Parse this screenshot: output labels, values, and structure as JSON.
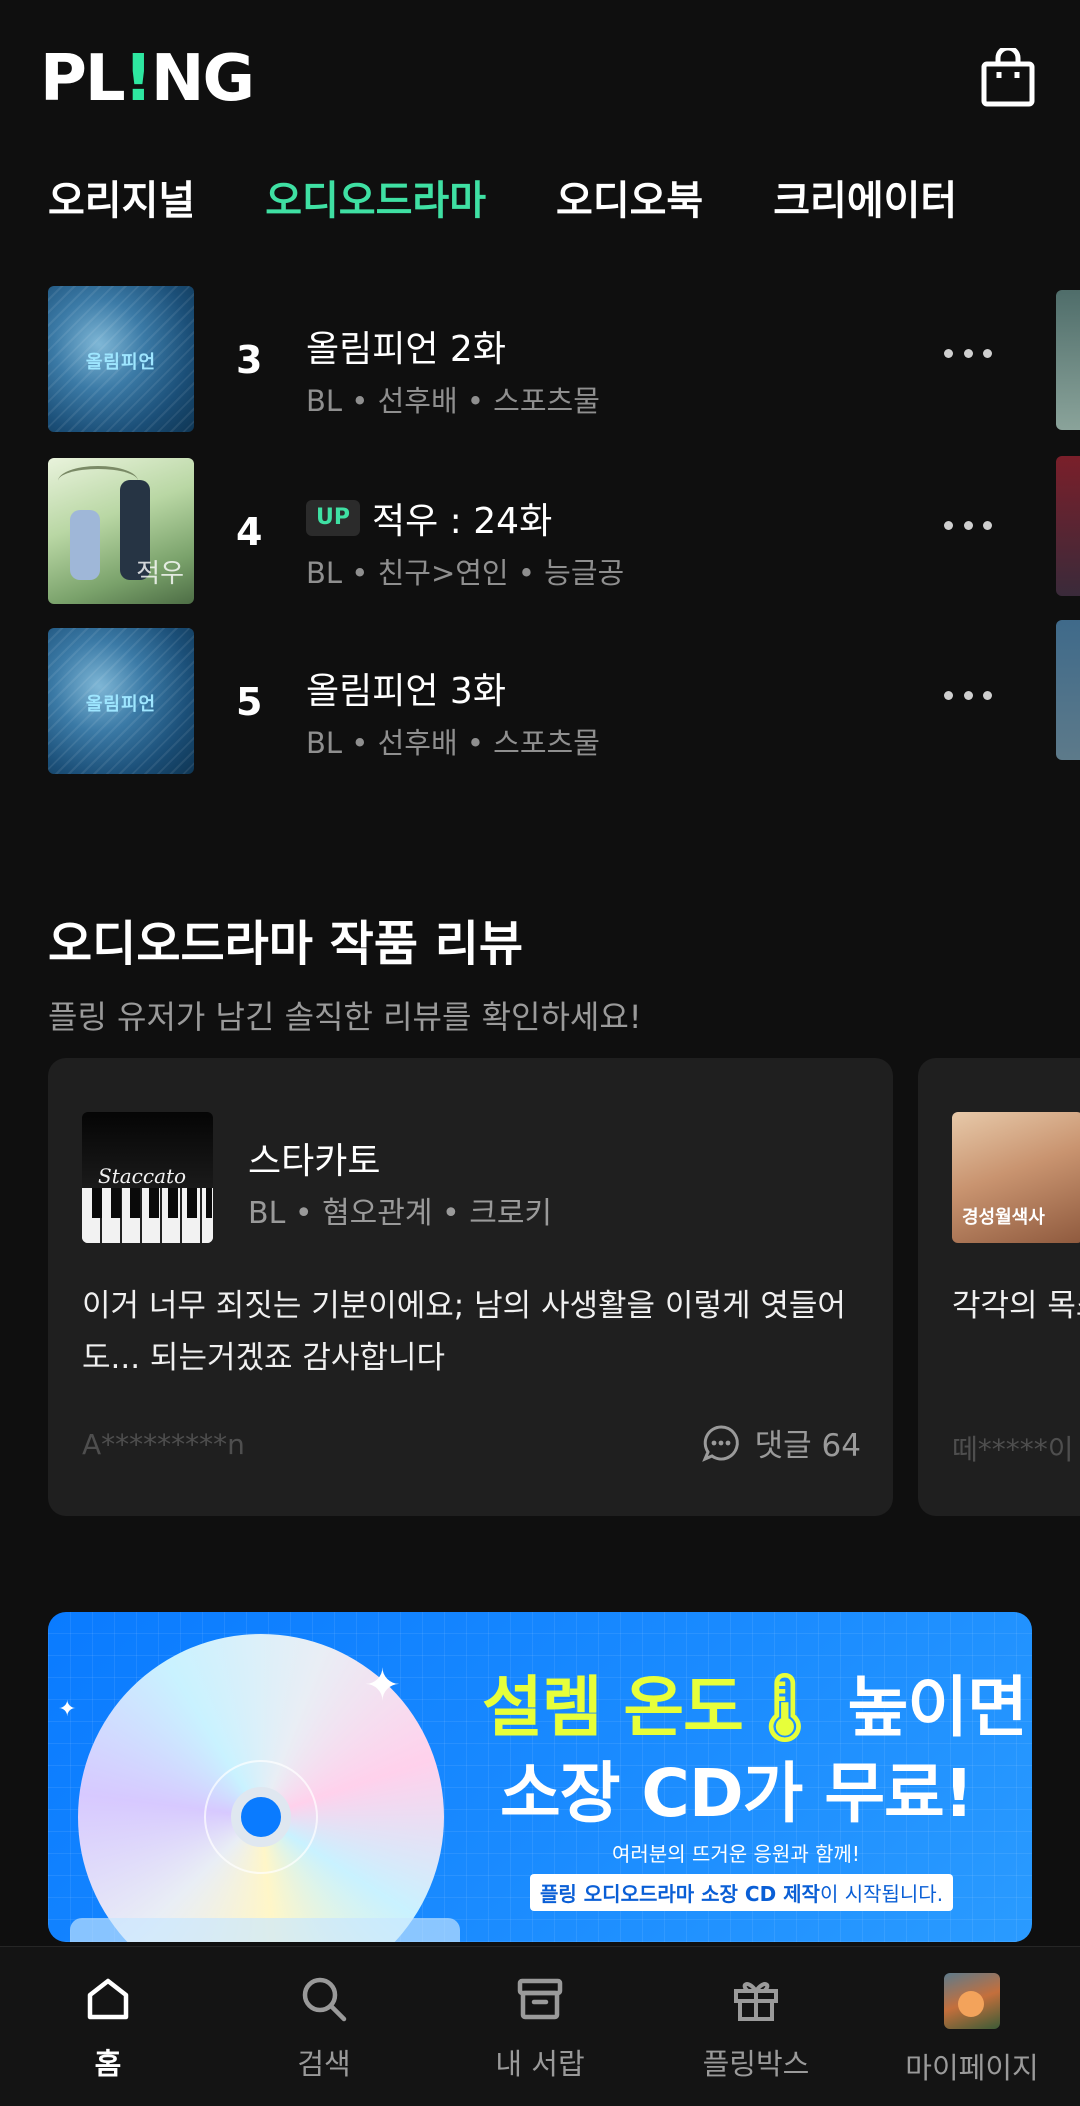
{
  "header": {
    "logo": "PL!NG",
    "logo_main": "PL",
    "logo_bang": "!",
    "logo_tail": "NG",
    "tabs": [
      {
        "label": "오리지널",
        "active": false
      },
      {
        "label": "오디오드라마",
        "active": true
      },
      {
        "label": "오디오북",
        "active": false
      },
      {
        "label": "크리에이터",
        "active": false
      }
    ]
  },
  "ranking": [
    {
      "rank": "3",
      "badge": "",
      "title": "올림피언 2화",
      "genre": "BL • 선후배 • 스포츠물",
      "cover": "ice",
      "cover_text": "올림피언"
    },
    {
      "rank": "4",
      "badge": "UP",
      "title": "적우 : 24화",
      "genre": "BL • 친구>연인 • 능글공",
      "cover": "park",
      "cover_text": "적우"
    },
    {
      "rank": "5",
      "badge": "",
      "title": "올림피언 3화",
      "genre": "BL • 선후배 • 스포츠물",
      "cover": "ice",
      "cover_text": "올림피언"
    }
  ],
  "reviews": {
    "title": "오디오드라마 작품 리뷰",
    "subtitle": "플링 유저가 남긴 솔직한 리뷰를 확인하세요!",
    "cards": [
      {
        "name": "스타카토",
        "genre": "BL • 혐오관계 • 크로키",
        "cover_text": "Staccato",
        "body": "이거 너무 죄짓는 기분이에요;  남의 사생활을 이렇게 엿들어도... 되는거겠죠 감사합니다",
        "user": "A*********n",
        "comments": "댓글 64"
      },
      {
        "name": "",
        "cover_text": "경성월색사",
        "body": "각각의 목소",
        "user": "떼*****이"
      }
    ]
  },
  "banner": {
    "line1_highlight": "설렘 온도",
    "line1_rest": "높이면",
    "line2": "소장 CD가 무료!",
    "line3": "여러분의 뜨거운 응원과 함께!",
    "line4_highlight": "플링 오디오드라마 소장 CD 제작",
    "line4_rest": "이 시작됩니다."
  },
  "bottom_nav": [
    {
      "label": "홈",
      "icon": "home-icon",
      "active": true
    },
    {
      "label": "검색",
      "icon": "search-icon",
      "active": false
    },
    {
      "label": "내 서랍",
      "icon": "drawer-icon",
      "active": false
    },
    {
      "label": "플링박스",
      "icon": "gift-icon",
      "active": false
    },
    {
      "label": "마이페이지",
      "icon": "avatar",
      "active": false
    }
  ],
  "colors": {
    "accent": "#3fe0a3",
    "background": "#0f0f0f",
    "card": "#1f1f1f",
    "banner_blue": "#0a7bff"
  }
}
